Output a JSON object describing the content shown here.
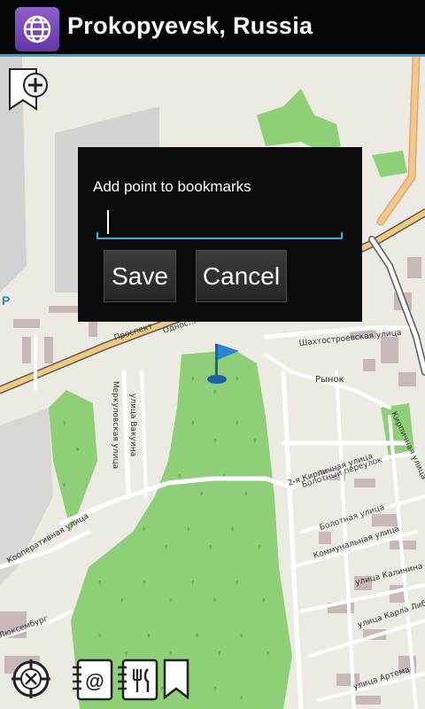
{
  "app": {
    "title": "Prokopyevsk, Russia",
    "icon": "globe-icon",
    "accent": "#2ea2d2"
  },
  "dialog": {
    "title": "Add point to bookmarks",
    "input_value": "",
    "save_label": "Save",
    "cancel_label": "Cancel"
  },
  "map": {
    "parking_label": "P",
    "marker_icon": "flag-marker-icon",
    "street_labels": {
      "prospekt": "Проспект",
      "odnoselk": "Однос…",
      "shakhto": "Шахтостроевская улица",
      "market": "Рынок",
      "merkulova": "Меркуловская улица",
      "vakulina": "улица Вакуина",
      "kirpich1": "2-я Кирпичная улица",
      "kirpich2": "Кирпичная улица",
      "bolotny": "Болотный переулок",
      "bolotnaya": "Болотная улица",
      "kommunal": "Коммунальная улица",
      "kalinina": "улица Калинина",
      "karla": "улица Карла Либкнехта",
      "artema": "улица Артема",
      "kooper": "Кооперативная улица",
      "lyuks": "Люксембург"
    }
  },
  "toolbar": {
    "items": [
      {
        "name": "compass-icon"
      },
      {
        "name": "contacts-address-icon"
      },
      {
        "name": "restaurants-icon"
      },
      {
        "name": "bookmark-icon"
      }
    ]
  }
}
